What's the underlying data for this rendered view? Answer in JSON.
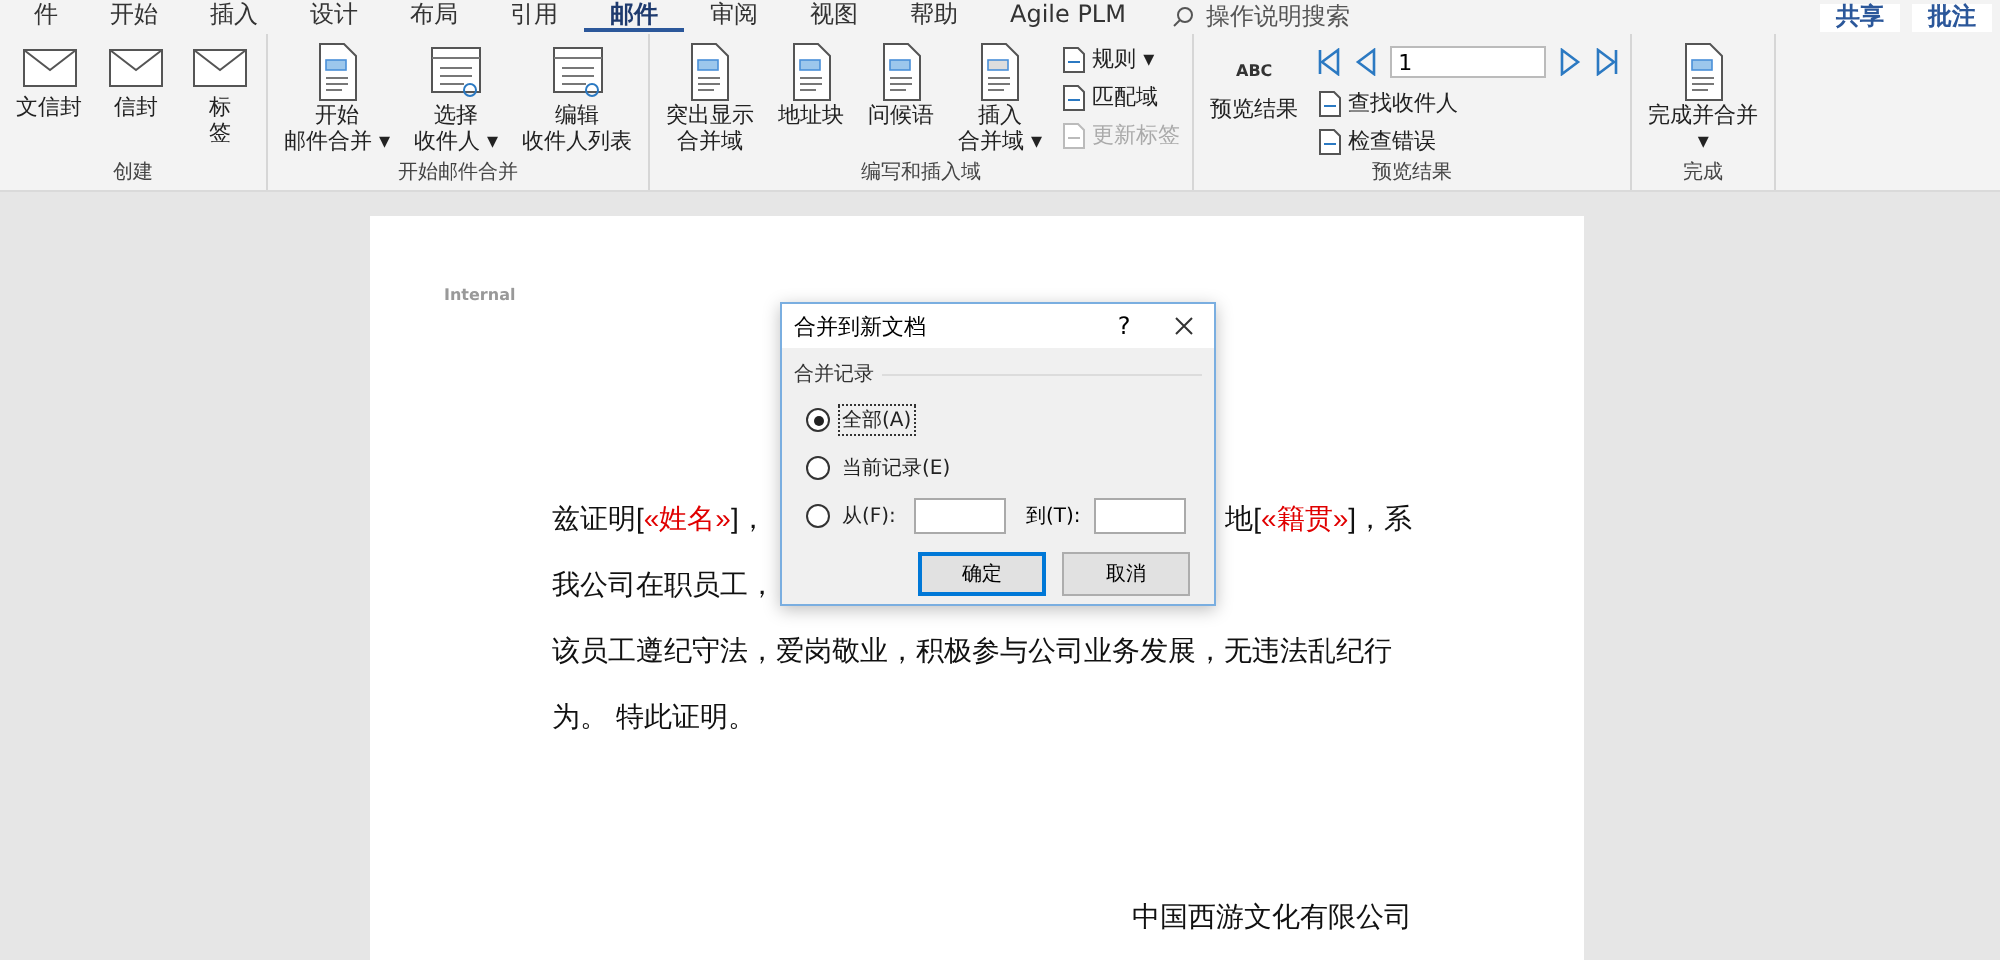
{
  "tabs": [
    {
      "label": "件",
      "selected": false
    },
    {
      "label": "开始",
      "selected": false
    },
    {
      "label": "插入",
      "selected": false
    },
    {
      "label": "设计",
      "selected": false
    },
    {
      "label": "布局",
      "selected": false
    },
    {
      "label": "引用",
      "selected": false
    },
    {
      "label": "邮件",
      "selected": true
    },
    {
      "label": "审阅",
      "selected": false
    },
    {
      "label": "视图",
      "selected": false
    },
    {
      "label": "帮助",
      "selected": false
    },
    {
      "label": "Agile PLM",
      "selected": false
    }
  ],
  "search": {
    "placeholder": "操作说明搜索"
  },
  "top_buttons": [
    "共享",
    "批注"
  ],
  "ribbon_groups": [
    {
      "label": "创建",
      "items": [
        {
          "kind": "big",
          "lines": [
            "文信封"
          ]
        },
        {
          "kind": "big",
          "lines": [
            "信封"
          ]
        },
        {
          "kind": "big",
          "lines": [
            "标",
            "签"
          ]
        }
      ]
    },
    {
      "label": "开始邮件合并",
      "items": [
        {
          "kind": "big",
          "lines": [
            "开始",
            "邮件合并 ▾"
          ]
        },
        {
          "kind": "big",
          "lines": [
            "选择",
            "收件人 ▾"
          ]
        },
        {
          "kind": "big",
          "lines": [
            "编辑",
            "收件人列表"
          ]
        }
      ]
    },
    {
      "label": "编写和插入域",
      "items": [
        {
          "kind": "big",
          "lines": [
            "突出显示",
            "合并域"
          ]
        },
        {
          "kind": "big",
          "lines": [
            "地址块"
          ]
        },
        {
          "kind": "big",
          "lines": [
            "问候语"
          ]
        },
        {
          "kind": "big",
          "lines": [
            "插入",
            "合并域 ▾"
          ]
        },
        {
          "kind": "small",
          "rows": [
            {
              "label": "规则 ▾",
              "disabled": false
            },
            {
              "label": "匹配域",
              "disabled": false
            },
            {
              "label": "更新标签",
              "disabled": true
            }
          ]
        }
      ]
    },
    {
      "label": "预览结果",
      "items": [
        {
          "kind": "preview",
          "mark": "ABC",
          "lines": [
            "预览结果"
          ]
        },
        {
          "kind": "nav",
          "record": "1",
          "rows": [
            {
              "label": "查找收件人",
              "disabled": false
            },
            {
              "label": "检查错误",
              "disabled": false
            }
          ]
        }
      ]
    },
    {
      "label": "完成",
      "items": [
        {
          "kind": "big",
          "lines": [
            "完成并合并",
            "▾"
          ]
        }
      ]
    }
  ],
  "document": {
    "header": "Internal",
    "lines": [
      {
        "left": [
          {
            "kind": "plain",
            "text": "兹证明["
          },
          {
            "kind": "field",
            "text": "«姓名»"
          },
          {
            "kind": "plain",
            "text": "]，"
          }
        ],
        "right": [
          {
            "kind": "plain",
            "text": "地["
          },
          {
            "kind": "field",
            "text": "«籍贯»"
          },
          {
            "kind": "plain",
            "text": "]，系"
          }
        ]
      },
      {
        "left": [
          {
            "kind": "plain",
            "text": "我公司在职员工，"
          }
        ]
      },
      {
        "left": [
          {
            "kind": "plain",
            "text": "该员工遵纪守法，爱岗敬业，积极参与公司业务发展，无违法乱纪行"
          }
        ]
      },
      {
        "left": [
          {
            "kind": "plain",
            "text": "为。  特此证明。"
          }
        ]
      }
    ],
    "signature": "中国西游文化有限公司"
  },
  "dialog": {
    "title": "合并到新文档",
    "help": "?",
    "group": "合并记录",
    "options": [
      {
        "kind": "radio",
        "label": "全部(A)",
        "selected": true
      },
      {
        "kind": "radio",
        "label": "当前记录(E)",
        "selected": false
      },
      {
        "kind": "range",
        "label": "从(F):",
        "selected": false,
        "to_label": "到(T):"
      }
    ],
    "buttons": [
      {
        "label": "确定",
        "default": true
      },
      {
        "label": "取消",
        "default": false
      }
    ]
  }
}
